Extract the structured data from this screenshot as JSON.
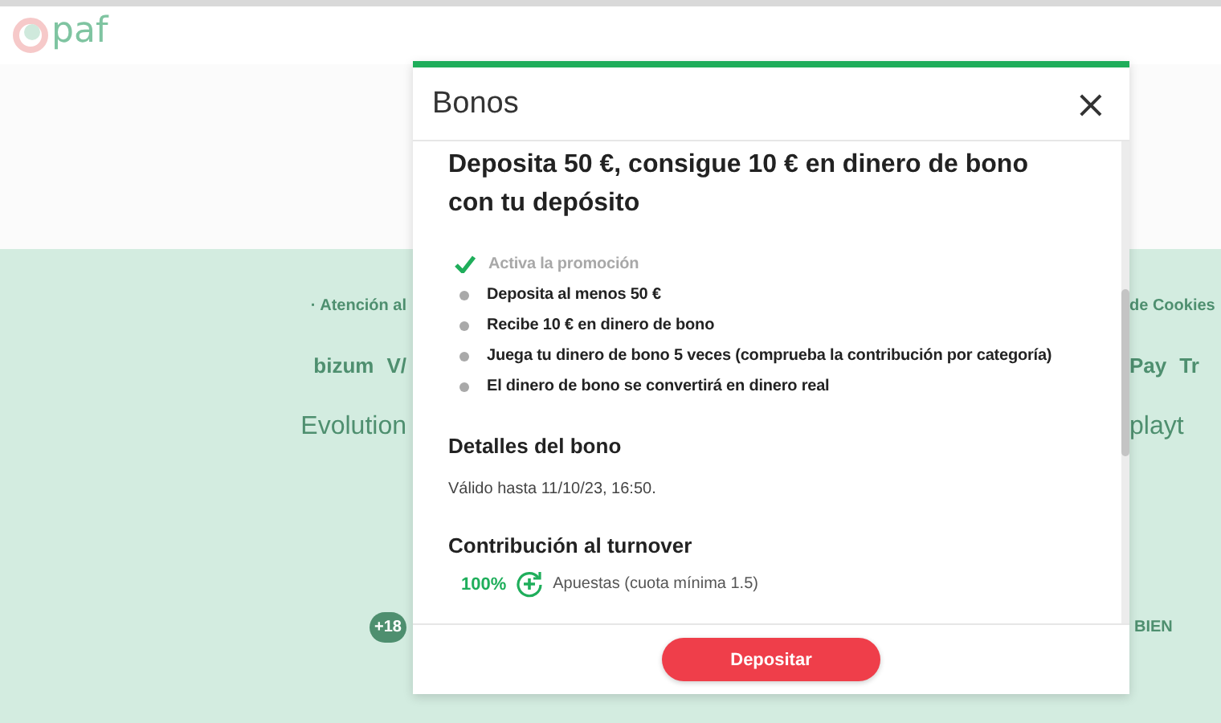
{
  "site": {
    "logo": "paf"
  },
  "footer": {
    "left": [
      {
        "kind": "link",
        "text": "· Atención al"
      },
      {
        "kind": "logos",
        "items": [
          "bizum",
          "V/"
        ]
      },
      {
        "kind": "big",
        "items": [
          "Evolution"
        ]
      },
      {
        "kind": "badge",
        "text": "+18"
      }
    ],
    "right": [
      {
        "kind": "link",
        "text": "de Cookies"
      },
      {
        "kind": "logos",
        "items": [
          "Pay",
          "Tr"
        ]
      },
      {
        "kind": "big",
        "items": [
          "playt"
        ]
      },
      {
        "kind": "badge",
        "text": "BIEN"
      }
    ]
  },
  "modal": {
    "title": "Bonos",
    "close": "×",
    "heading": "Deposita 50 €, consigue 10 € en dinero de bono con tu depósito",
    "steps": [
      {
        "text": "Activa la promoción",
        "done": true
      },
      {
        "text": "Deposita al menos 50 €",
        "done": false
      },
      {
        "text": "Recibe 10 € en dinero de bono",
        "done": false
      },
      {
        "text": "Juega tu dinero de bono 5 veces (comprueba la contribución por categoría)",
        "done": false
      },
      {
        "text": "El dinero de bono se convertirá en dinero real",
        "done": false
      }
    ],
    "details_title": "Detalles del bono",
    "details": "Válido hasta 11/10/23, 16:50.",
    "contribution_title": "Contribución al turnover",
    "contributions": [
      {
        "percent": "100%",
        "label": "Apuestas (cuota mínima 1.5)"
      }
    ],
    "button": "Depositar"
  }
}
